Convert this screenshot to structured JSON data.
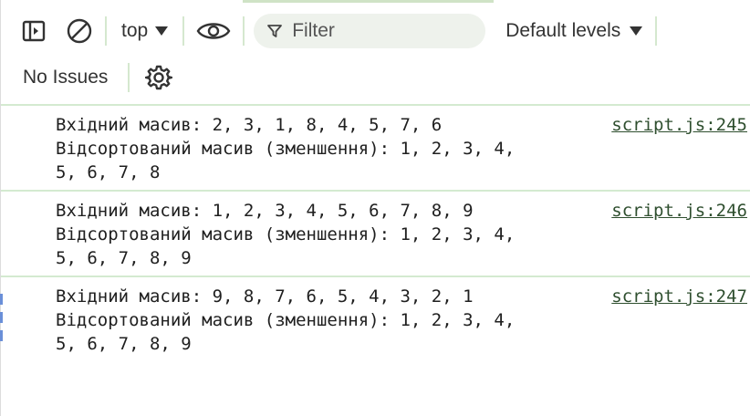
{
  "toolbar": {
    "context_label": "top",
    "filter_placeholder": "Filter",
    "levels_label": "Default levels",
    "issues_label": "No Issues"
  },
  "messages": [
    {
      "text": "Вхідний масив: 2, 3, 1, 8, 4, 5, 7, 6\nВідсортований масив (зменшення): 1, 2, 3, 4, 5, 6, 7, 8",
      "source": "script.js:245"
    },
    {
      "text": "Вхідний масив: 1, 2, 3, 4, 5, 6, 7, 8, 9\nВідсортований масив (зменшення): 1, 2, 3, 4, 5, 6, 7, 8, 9",
      "source": "script.js:246"
    },
    {
      "text": "Вхідний масив: 9, 8, 7, 6, 5, 4, 3, 2, 1\nВідсортований масив (зменшення): 1, 2, 3, 4, 5, 6, 7, 8, 9",
      "source": "script.js:247"
    }
  ],
  "icons": {
    "sidebar": "sidebar-toggle-icon",
    "clear": "clear-console-icon",
    "eye": "eye-icon",
    "filter": "filter-icon",
    "settings": "gear-icon"
  },
  "colors": {
    "separator": "#d4ead0",
    "filter_bg": "#eef2ec",
    "link": "#2f4f2f"
  }
}
